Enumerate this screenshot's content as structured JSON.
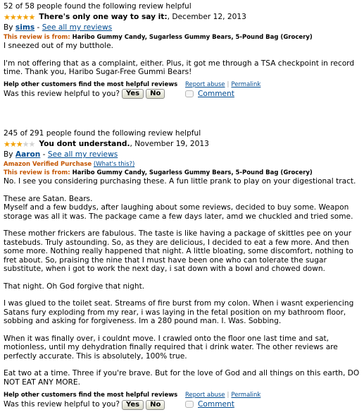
{
  "reviews": [
    {
      "helpful": "52 of 58 people found the following review helpful",
      "stars_filled": 5,
      "stars_total": 5,
      "title": "There's only one way to say it:",
      "date": ", December 12, 2013",
      "by": "By ",
      "author": "sims",
      "see_all": "See all my reviews",
      "from_label": "This review is from: ",
      "product": "Haribo Gummy Candy, Sugarless Gummy Bears, 5-Pound Bag (Grocery)",
      "body": [
        "I sneezed out of my butthole.",
        "",
        "I'm not offering that as a complaint, either. Plus, it got me through a TSA checkpoint in record time. Thank you, Haribo Sugar-Free Gummi Bears!"
      ],
      "help_question": "Help other customers find the most helpful reviews",
      "vote_prompt": "Was this review helpful to you?",
      "yes": "Yes",
      "no": "No",
      "report": "Report abuse",
      "permalink": "Permalink",
      "comment": "Comment"
    },
    {
      "helpful": "245 of 291 people found the following review helpful",
      "stars_filled": 3,
      "stars_total": 5,
      "title": "You dont understand.",
      "date": ", November 19, 2013",
      "by": "By ",
      "author": "Aaron",
      "see_all": "See all my reviews",
      "verified_label": "Amazon Verified Purchase",
      "whats_this": "(What's this?)",
      "from_label": "This review is from: ",
      "product": "Haribo Gummy Candy, Sugarless Gummy Bears, 5-Pound Bag (Grocery)",
      "body": [
        "No. I see you considering purchasing these. A fun little prank to play on your digestional tract.",
        "",
        "These are Satan. Bears.",
        "Myself and a few buddys, after laughing about some reviews, decided to buy some. Weapon storage was all it was. The package came a few days later, amd we chuckled and tried some.",
        "",
        "These mother frickers are fabulous. The taste is like having a package of skittles pee on your tastebuds. Truly astounding. So, as they are delicious, I decided to eat a few more. And then some more. Nothing really happened that night. A little bloating, some discomfort, nothing to fret about. So, praising the nine that I must have been one who can tolerate the sugar substitute, when i got to work the next day, i sat down with a bowl and chowed down.",
        "",
        "That night. Oh God forgive that night.",
        "",
        "I was glued to the toilet seat. Streams of fire burst from my colon. When i wasnt experiencing Satans fury exploding from my rear, i was laying in the fetal position on my bathroom floor, sobbing and asking for forgiveness. Im a 280 pound man. I. Was. Sobbing.",
        "",
        "When it was finally over, i couldnt move. I crawled onto the floor one last time and sat, motionless, until my dehydration finally required that i drink water. The other reviews are perfectly accurate. This is absolutely, 100% true.",
        "",
        "Eat two at a time. Three if you're brave. But for the love of God and all things on this earth, DO NOT EAT ANY MORE."
      ],
      "help_question": "Help other customers find the most helpful reviews",
      "vote_prompt": "Was this review helpful to you?",
      "yes": "Yes",
      "no": "No",
      "report": "Report abuse",
      "permalink": "Permalink",
      "comment": "Comment"
    }
  ],
  "colors": {
    "link": "#004b91",
    "from_label": "#c45500",
    "star": "#f2a000"
  }
}
